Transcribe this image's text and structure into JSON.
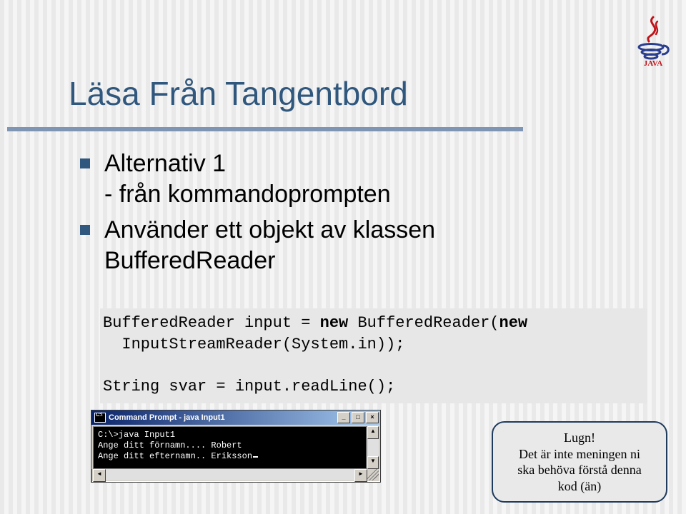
{
  "title": "Läsa Från Tangentbord",
  "bullets": {
    "b1_line1": "Alternativ 1",
    "b1_line2": "- från kommandoprompten",
    "b2_line1": "Använder ett objekt av klassen",
    "b2_line2": "BufferedReader"
  },
  "code": {
    "l1a": "BufferedReader input = ",
    "kw1": "new",
    "l1b": " BufferedReader(",
    "kw2": "new",
    "l2": "  InputStreamReader(System.in));",
    "blank": "",
    "l3": "String svar = input.readLine();"
  },
  "cmd": {
    "title": "Command Prompt - java Input1",
    "line1": "C:\\>java Input1",
    "line2": "Ange ditt förnamn.... Robert",
    "line3": "Ange ditt efternamn.. Eriksson"
  },
  "winbuttons": {
    "min": "_",
    "max": "□",
    "close": "×",
    "up": "▲",
    "down": "▼",
    "left": "◄",
    "right": "►"
  },
  "callout": {
    "l1": "Lugn!",
    "l2": "Det är inte meningen ni",
    "l3": "ska behöva förstå denna",
    "l4": "kod (än)"
  }
}
